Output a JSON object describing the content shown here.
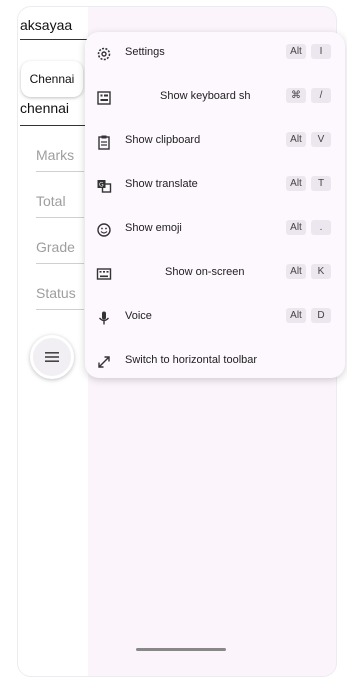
{
  "form": {
    "name_value": "aksayaa",
    "city_chip": "Chennai",
    "city_value": "chennai",
    "marks_placeholder": "Marks",
    "total_placeholder": "Total",
    "grade_placeholder": "Grade",
    "status_placeholder": "Status"
  },
  "menu": {
    "items": [
      {
        "label": "Settings",
        "icon": "gear-icon",
        "keys": [
          "Alt",
          "I"
        ]
      },
      {
        "label": "Show keyboard sh",
        "icon": "keyboard-shortcuts-icon",
        "keys": [
          "⌘",
          "/"
        ]
      },
      {
        "label": "Show clipboard",
        "icon": "clipboard-icon",
        "keys": [
          "Alt",
          "V"
        ]
      },
      {
        "label": "Show translate",
        "icon": "translate-icon",
        "keys": [
          "Alt",
          "T"
        ]
      },
      {
        "label": "Show emoji",
        "icon": "emoji-icon",
        "keys": [
          "Alt",
          "."
        ]
      },
      {
        "label": "Show on-screen",
        "icon": "keyboard-icon",
        "keys": [
          "Alt",
          "K"
        ]
      },
      {
        "label": "Voice",
        "icon": "microphone-icon",
        "keys": [
          "Alt",
          "D"
        ]
      },
      {
        "label": "Switch to horizontal toolbar",
        "icon": "expand-arrow-icon",
        "keys": []
      }
    ]
  }
}
